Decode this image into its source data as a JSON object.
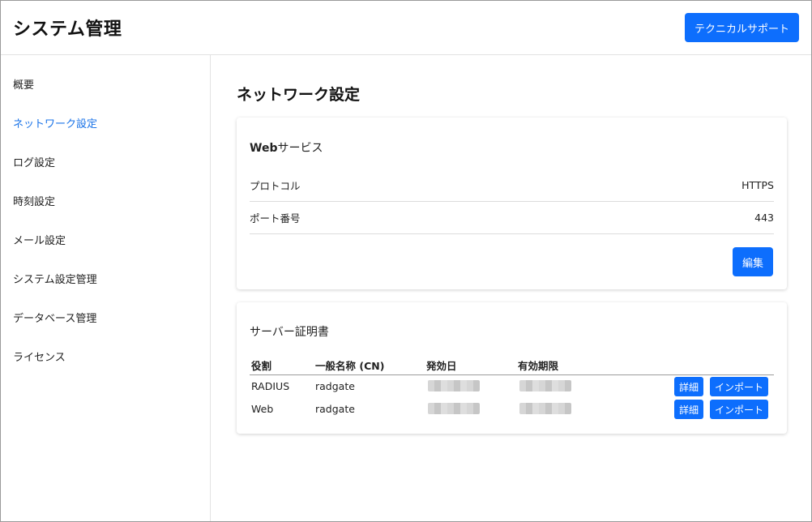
{
  "header": {
    "title": "システム管理",
    "support_label": "テクニカルサポート"
  },
  "sidebar": {
    "active_index": 1,
    "items": [
      {
        "label": "概要"
      },
      {
        "label": "ネットワーク設定"
      },
      {
        "label": "ログ設定"
      },
      {
        "label": "時刻設定"
      },
      {
        "label": "メール設定"
      },
      {
        "label": "システム設定管理"
      },
      {
        "label": "データベース管理"
      },
      {
        "label": "ライセンス"
      }
    ]
  },
  "main": {
    "page_title": "ネットワーク設定",
    "web_service": {
      "title_bold": "Web",
      "title_rest": "サービス",
      "rows": [
        {
          "label": "プロトコル",
          "value": "HTTPS"
        },
        {
          "label": "ポート番号",
          "value": "443"
        }
      ],
      "edit_label": "編集"
    },
    "certificates": {
      "title": "サーバー証明書",
      "columns": [
        "役割",
        "一般名称 (CN)",
        "発効日",
        "有効期限"
      ],
      "rows": [
        {
          "role": "RADIUS",
          "cn": "radgate",
          "detail_label": "詳細",
          "import_label": "インポート"
        },
        {
          "role": "Web",
          "cn": "radgate",
          "detail_label": "詳細",
          "import_label": "インポート"
        }
      ]
    }
  },
  "colors": {
    "accent": "#0d6efd",
    "active_nav": "#1a73e8"
  }
}
